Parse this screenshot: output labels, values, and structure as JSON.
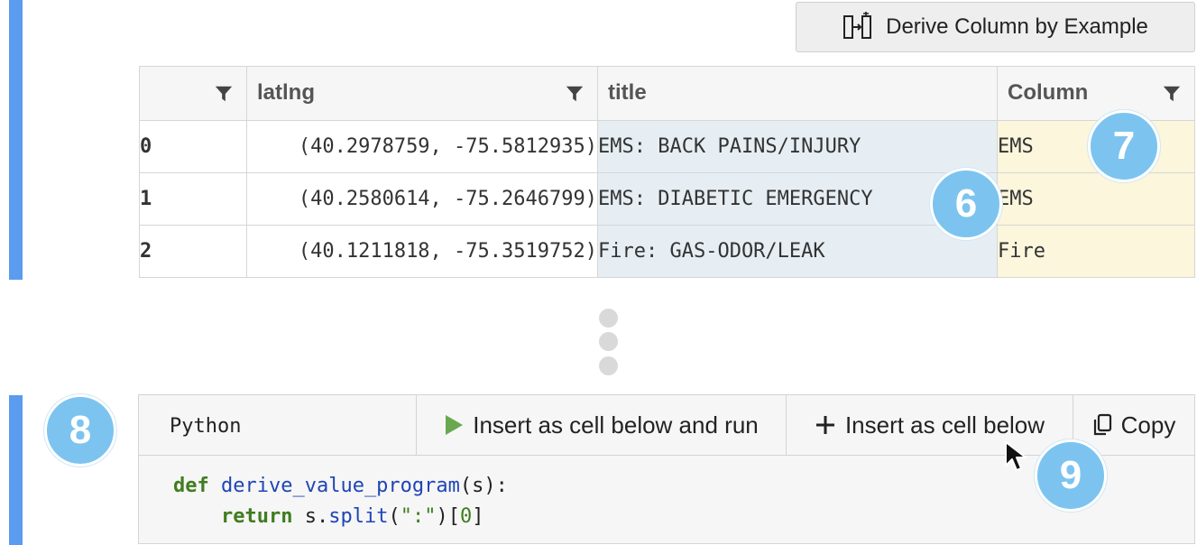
{
  "toolbar": {
    "derive_label": "Derive Column by Example",
    "derive_icon": "derive-column-icon"
  },
  "table": {
    "columns": [
      {
        "label": "",
        "filter": true
      },
      {
        "label": "latlng",
        "filter": true
      },
      {
        "label": "title",
        "filter": false
      },
      {
        "label": "Column",
        "filter": true
      }
    ],
    "rows": [
      {
        "index": "0",
        "latlng": "(40.2978759, -75.5812935)",
        "title": "EMS: BACK PAINS/INJURY",
        "column": "EMS",
        "column_state": "suggested"
      },
      {
        "index": "1",
        "latlng": "(40.2580614, -75.2646799)",
        "title": "EMS: DIABETIC EMERGENCY",
        "column": "EMS",
        "column_state": "entered"
      },
      {
        "index": "2",
        "latlng": "(40.1211818, -75.3519752)",
        "title": "Fire: GAS-ODOR/LEAK",
        "column": "Fire",
        "column_state": "suggested"
      }
    ]
  },
  "badges": {
    "b6": "6",
    "b7": "7",
    "b8": "8",
    "b9": "9"
  },
  "code_panel": {
    "language": "Python",
    "run_label": "Insert as cell below and run",
    "insert_label": "Insert as cell below",
    "copy_label": "Copy",
    "line1": {
      "kw": "def",
      "fn": "derive_value_program",
      "rest": "(s):"
    },
    "line2": {
      "indent": "    ",
      "kw": "return",
      "pre": " s.",
      "fn": "split",
      "mid": "(",
      "str": "\":\"",
      "post": ")[",
      "num": "0",
      "end": "]"
    }
  },
  "colors": {
    "accent_bar": "#5b9bf0",
    "badge": "#7cc4ef",
    "title_highlight": "#e6eef3",
    "column_highlight": "#fbf6dc",
    "run_icon": "#6aa84f"
  }
}
